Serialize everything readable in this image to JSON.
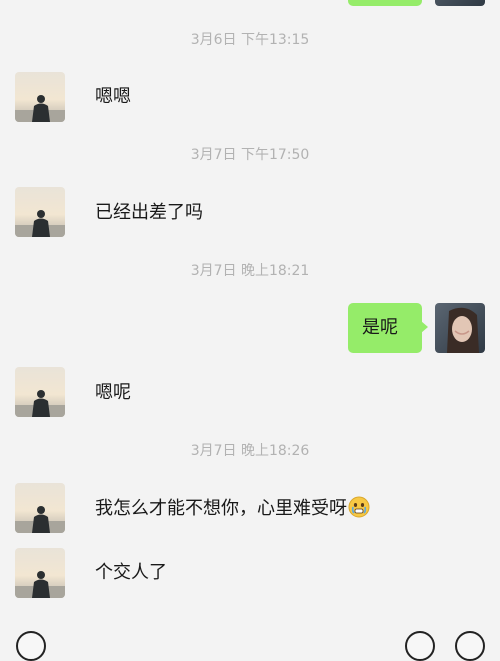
{
  "top_outgoing_partial": {
    "sender": "me"
  },
  "messages": [
    {
      "type": "timestamp",
      "text": "3月6日 下午13:15"
    },
    {
      "type": "incoming",
      "text": "嗯嗯"
    },
    {
      "type": "timestamp",
      "text": "3月7日 下午17:50"
    },
    {
      "type": "incoming",
      "text": "已经出差了吗"
    },
    {
      "type": "timestamp",
      "text": "3月7日 晚上18:21"
    },
    {
      "type": "outgoing",
      "text": "是呢"
    },
    {
      "type": "incoming",
      "text": "嗯呢"
    },
    {
      "type": "timestamp",
      "text": "3月7日 晚上18:26"
    },
    {
      "type": "incoming",
      "text": "我怎么才能不想你，心里难受呀",
      "emoji": "crying-face"
    },
    {
      "type": "incoming",
      "text": "个交人了"
    }
  ],
  "colors": {
    "background": "#f3f3f3",
    "outgoing_bubble": "#95ec69",
    "timestamp_text": "#b2b2b2"
  },
  "icons": {
    "input_bar_left": "voice-icon",
    "input_bar_right_1": "emoji-icon",
    "input_bar_right_2": "add-icon"
  }
}
